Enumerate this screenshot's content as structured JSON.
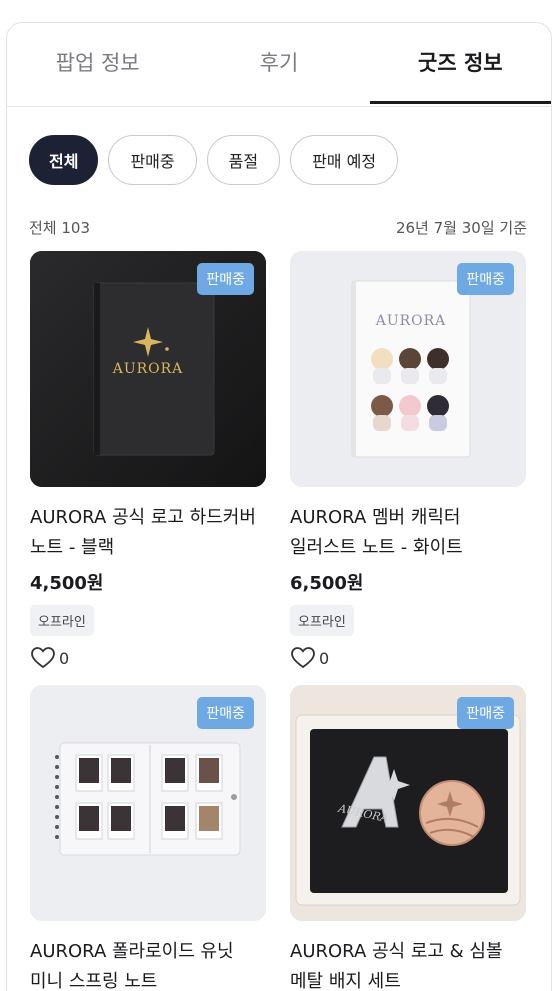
{
  "tabs": [
    {
      "label": "팝업 정보",
      "active": false
    },
    {
      "label": "후기",
      "active": false
    },
    {
      "label": "굿즈 정보",
      "active": true
    }
  ],
  "filters": [
    {
      "label": "전체",
      "active": true
    },
    {
      "label": "판매중",
      "active": false
    },
    {
      "label": "품절",
      "active": false
    },
    {
      "label": "판매 예정",
      "active": false
    }
  ],
  "summary": {
    "total": "전체 103",
    "date": "26년 7월 30일 기준"
  },
  "products": [
    {
      "badge": "판매중",
      "title_line1": "AURORA 공식 로고 하드커버",
      "title_line2": "노트 - 블랙",
      "price": "4,500원",
      "tag": "오프라인",
      "likes": "0",
      "thumb_text": "AURORA"
    },
    {
      "badge": "판매중",
      "title_line1": "AURORA 멤버 캐릭터",
      "title_line2": "일러스트 노트 - 화이트",
      "price": "6,500원",
      "tag": "오프라인",
      "likes": "0",
      "thumb_text": "AURORA"
    },
    {
      "badge": "판매중",
      "title_line1": "AURORA 폴라로이드 유닛",
      "title_line2": "미니 스프링 노트",
      "price": "",
      "tag": "",
      "likes": "",
      "thumb_text": ""
    },
    {
      "badge": "판매중",
      "title_line1": "AURORA 공식 로고 & 심볼",
      "title_line2": "메탈 배지 세트",
      "price": "",
      "tag": "",
      "likes": "",
      "thumb_text": "AURORA"
    }
  ]
}
